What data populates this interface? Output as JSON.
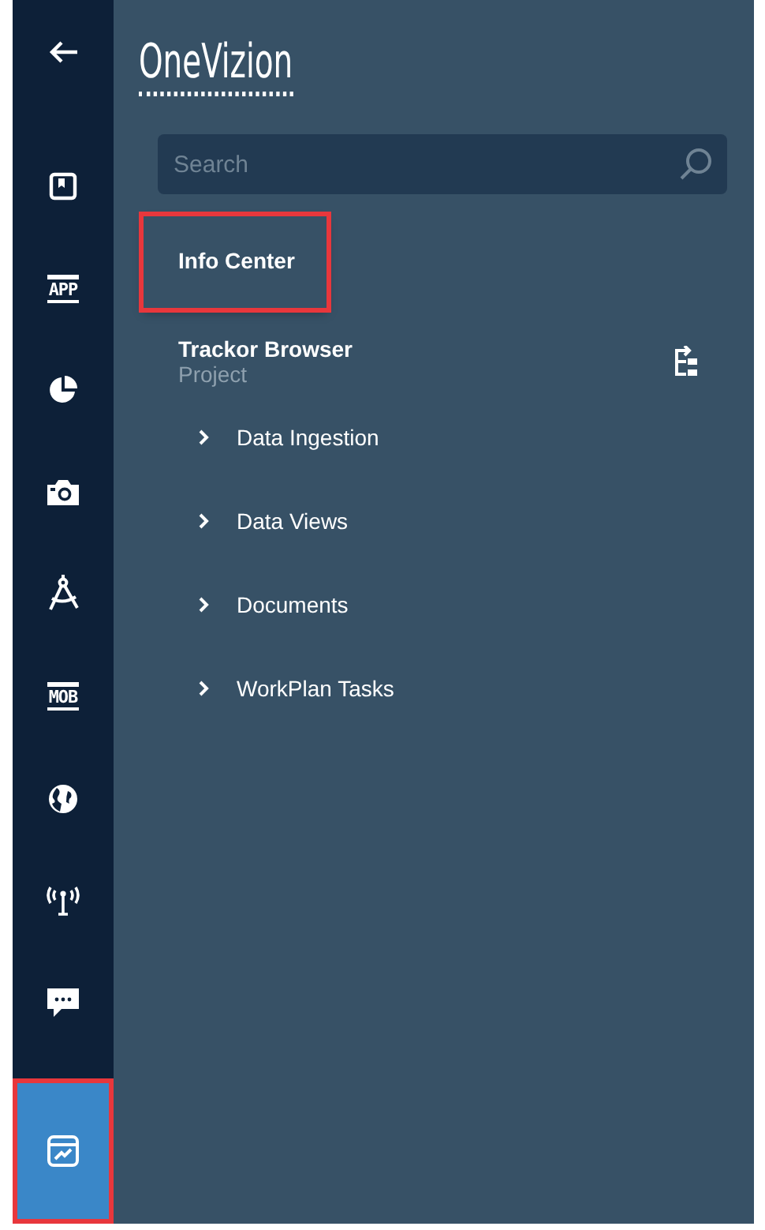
{
  "rail": {
    "back": true,
    "items": [
      {
        "kind": "bookmark",
        "selected": false,
        "highlighted": false
      },
      {
        "kind": "label",
        "text": "APP",
        "selected": false,
        "highlighted": false
      },
      {
        "kind": "pie",
        "selected": false,
        "highlighted": false
      },
      {
        "kind": "camera",
        "selected": false,
        "highlighted": false
      },
      {
        "kind": "compass",
        "selected": false,
        "highlighted": false
      },
      {
        "kind": "label",
        "text": "MOB",
        "selected": false,
        "highlighted": false
      },
      {
        "kind": "globe",
        "selected": false,
        "highlighted": false
      },
      {
        "kind": "antenna",
        "selected": false,
        "highlighted": false
      },
      {
        "kind": "chat",
        "selected": false,
        "highlighted": false
      },
      {
        "kind": "chart",
        "selected": true,
        "highlighted": true
      }
    ]
  },
  "logo": "OneVizion",
  "search": {
    "placeholder": "Search"
  },
  "info_center": {
    "label": "Info Center",
    "highlighted": true
  },
  "trackor_browser": {
    "title": "Trackor Browser",
    "subtitle": "Project"
  },
  "tree": [
    {
      "label": "Data Ingestion",
      "expanded": false
    },
    {
      "label": "Data Views",
      "expanded": false
    },
    {
      "label": "Documents",
      "expanded": false
    },
    {
      "label": "WorkPlan Tasks",
      "expanded": false
    }
  ]
}
